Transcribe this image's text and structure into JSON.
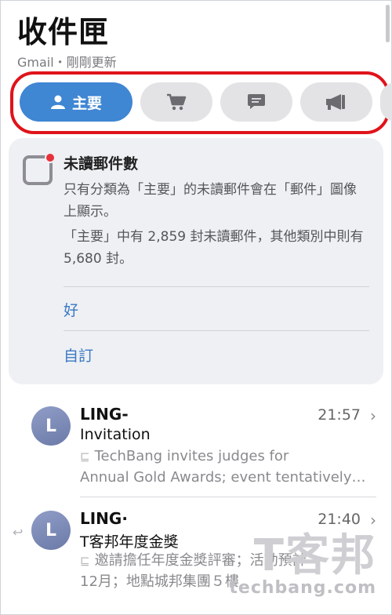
{
  "header": {
    "title": "收件匣",
    "subtitle": "Gmail・剛剛更新"
  },
  "tabs": [
    {
      "label": "主要",
      "icon": "person-icon",
      "active": true
    },
    {
      "label": "",
      "icon": "cart-icon",
      "active": false
    },
    {
      "label": "",
      "icon": "chat-icon",
      "active": false
    },
    {
      "label": "",
      "icon": "megaphone-icon",
      "active": false
    }
  ],
  "card": {
    "title": "未讀郵件數",
    "line1": "只有分類為「主要」的未讀郵件會在「郵件」圖像上顯示。",
    "line2": "「主要」中有 2,859 封未讀郵件，其他類別中則有 5,680 封。",
    "ok_label": "好",
    "customize_label": "自訂"
  },
  "emails": [
    {
      "avatar": "L",
      "sender": "LING-",
      "time": "21:57",
      "subject": "Invitation",
      "snippet_line1": "TechBang invites judges for",
      "snippet_line2": "Annual Gold Awards; event tentatively…"
    },
    {
      "avatar": "L",
      "sender": "LING·",
      "time": "21:40",
      "subject": "T客邦年度金獎",
      "snippet_line1": "邀請擔任年度金獎評審；活動預計",
      "snippet_line2": "12月；地點城邦集團５樓"
    }
  ],
  "watermark": {
    "text": "T客邦",
    "url": "techbang.com"
  },
  "colors": {
    "accent": "#3f86d3",
    "highlight": "#e0131b",
    "badge": "#e8313a"
  }
}
